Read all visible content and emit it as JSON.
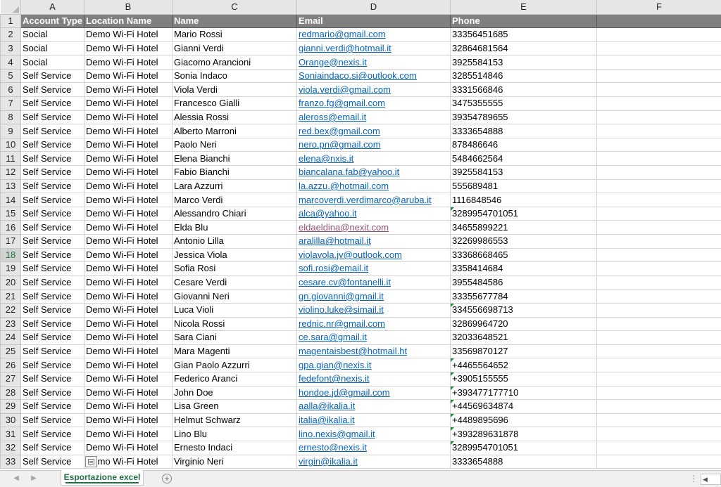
{
  "columns": [
    "A",
    "B",
    "C",
    "D",
    "E",
    "F"
  ],
  "header_row": {
    "row_number": "1",
    "cells": [
      "Account Type",
      "Location Name",
      "Name",
      "Email",
      "Phone",
      ""
    ]
  },
  "selected_row": "18",
  "rows": [
    {
      "n": "2",
      "type": "Social",
      "location": "Demo Wi-Fi Hotel",
      "name": "Mario Rossi",
      "email": "redmario@gmail.com",
      "phone": "33356451685",
      "phone_warning": false
    },
    {
      "n": "3",
      "type": "Social",
      "location": "Demo Wi-Fi Hotel",
      "name": "Gianni Verdi",
      "email": "gianni.verdi@hotmail.it",
      "phone": "32864681564",
      "phone_warning": false
    },
    {
      "n": "4",
      "type": "Social",
      "location": "Demo Wi-Fi Hotel",
      "name": "Giacomo Arancioni",
      "email": "Orange@nexis.it",
      "phone": "3925584153",
      "phone_warning": false
    },
    {
      "n": "5",
      "type": "Self Service",
      "location": "Demo Wi-Fi Hotel",
      "name": "Sonia Indaco",
      "email": "Soniaindaco.si@outlook.com",
      "phone": "3285514846",
      "phone_warning": false
    },
    {
      "n": "6",
      "type": "Self Service",
      "location": "Demo Wi-Fi Hotel",
      "name": "Viola Verdi",
      "email": "viola.verdi@gmail.com",
      "phone": "3331566846",
      "phone_warning": false
    },
    {
      "n": "7",
      "type": "Self Service",
      "location": "Demo Wi-Fi Hotel",
      "name": "Francesco Gialli",
      "email": "franzo.fg@gmail.com",
      "phone": "3475355555",
      "phone_warning": false
    },
    {
      "n": "8",
      "type": "Self Service",
      "location": "Demo Wi-Fi Hotel",
      "name": "Alessia Rossi",
      "email": "aleross@email.it",
      "phone": "39354789655",
      "phone_warning": false
    },
    {
      "n": "9",
      "type": "Self Service",
      "location": "Demo Wi-Fi Hotel",
      "name": "Alberto Marroni",
      "email": "red.bex@gmail.com",
      "phone": "3333654888",
      "phone_warning": false
    },
    {
      "n": "10",
      "type": "Self Service",
      "location": "Demo Wi-Fi Hotel",
      "name": "Paolo Neri",
      "email": "nero.pn@gmail.com",
      "phone": "878486646",
      "phone_warning": false
    },
    {
      "n": "11",
      "type": "Self Service",
      "location": "Demo Wi-Fi Hotel",
      "name": "Elena Bianchi",
      "email": "elena@nxis.it",
      "phone": "5484662564",
      "phone_warning": false
    },
    {
      "n": "12",
      "type": "Self Service",
      "location": "Demo Wi-Fi Hotel",
      "name": "Fabio Bianchi",
      "email": "biancalana.fab@yahoo.it",
      "phone": "3925584153",
      "phone_warning": false
    },
    {
      "n": "13",
      "type": "Self Service",
      "location": "Demo Wi-Fi Hotel",
      "name": "Lara Azzurri",
      "email": "la.azzu.@hotmail.com",
      "phone": "555689481",
      "phone_warning": false
    },
    {
      "n": "14",
      "type": "Self Service",
      "location": "Demo Wi-Fi Hotel",
      "name": "Marco Verdi",
      "email": "marcoverdi.verdimarco@aruba.it",
      "phone": "1116848546",
      "phone_warning": false
    },
    {
      "n": "15",
      "type": "Self Service",
      "location": "Demo Wi-Fi Hotel",
      "name": "Alessandro Chiari",
      "email": "alca@yahoo.it",
      "phone": "3289954701051",
      "phone_warning": true
    },
    {
      "n": "16",
      "type": "Self Service",
      "location": "Demo Wi-Fi Hotel",
      "name": "Elda Blu",
      "email": "eldaeldina@nexit.com",
      "phone": "34655899221",
      "phone_warning": false,
      "visited": true
    },
    {
      "n": "17",
      "type": "Self Service",
      "location": "Demo Wi-Fi Hotel",
      "name": "Antonio Lilla",
      "email": "aralilla@hotmail.it",
      "phone": "32269986553",
      "phone_warning": false
    },
    {
      "n": "18",
      "type": "Self Service",
      "location": "Demo Wi-Fi Hotel",
      "name": "Jessica Viola",
      "email": "violavola.jv@outlook.com",
      "phone": "33368668465",
      "phone_warning": false
    },
    {
      "n": "19",
      "type": "Self Service",
      "location": "Demo Wi-Fi Hotel",
      "name": "Sofia Rosi",
      "email": "sofi.rosi@email.it",
      "phone": "3358414684",
      "phone_warning": false
    },
    {
      "n": "20",
      "type": "Self Service",
      "location": "Demo Wi-Fi Hotel",
      "name": "Cesare Verdi",
      "email": "cesare.cv@fontanelli.it",
      "phone": "3955484586",
      "phone_warning": false
    },
    {
      "n": "21",
      "type": "Self Service",
      "location": "Demo Wi-Fi Hotel",
      "name": "Giovanni Neri",
      "email": "gn.giovanni@gmail.it",
      "phone": "33355677784",
      "phone_warning": false
    },
    {
      "n": "22",
      "type": "Self Service",
      "location": "Demo Wi-Fi Hotel",
      "name": "Luca Violi",
      "email": "violino.luke@simail.it",
      "phone": "334556698713",
      "phone_warning": true
    },
    {
      "n": "23",
      "type": "Self Service",
      "location": "Demo Wi-Fi Hotel",
      "name": "Nicola Rossi",
      "email": "rednic.nr@gmail.com",
      "phone": "32869964720",
      "phone_warning": false
    },
    {
      "n": "24",
      "type": "Self Service",
      "location": "Demo Wi-Fi Hotel",
      "name": "Sara Ciani",
      "email": "ce.sara@gmail.it",
      "phone": "32033648521",
      "phone_warning": false
    },
    {
      "n": "25",
      "type": "Self Service",
      "location": "Demo Wi-Fi Hotel",
      "name": "Mara Magenti",
      "email": "magentaisbest@hotmail.ht",
      "phone": "33569870127",
      "phone_warning": false
    },
    {
      "n": "26",
      "type": "Self Service",
      "location": "Demo Wi-Fi Hotel",
      "name": "Gian Paolo Azzurri",
      "email": "gpa.gian@nexis.it",
      "phone": "+4465564652",
      "phone_warning": true
    },
    {
      "n": "27",
      "type": "Self Service",
      "location": "Demo Wi-Fi Hotel",
      "name": "Federico Aranci",
      "email": "fedefont@nexis.it",
      "phone": "+3905155555",
      "phone_warning": true
    },
    {
      "n": "28",
      "type": "Self Service",
      "location": "Demo Wi-Fi Hotel",
      "name": "John Doe",
      "email": "hondoe.jd@gmail.com",
      "phone": "+393477177710",
      "phone_warning": true
    },
    {
      "n": "29",
      "type": "Self Service",
      "location": "Demo Wi-Fi Hotel",
      "name": "Lisa Green",
      "email": "aalla@ikalia.it",
      "phone": "+44569634874",
      "phone_warning": true
    },
    {
      "n": "30",
      "type": "Self Service",
      "location": "Demo Wi-Fi Hotel",
      "name": "Helmut Schwarz",
      "email": "italia@ikalia.it",
      "phone": "+4489895696",
      "phone_warning": true
    },
    {
      "n": "31",
      "type": "Self Service",
      "location": "Demo Wi-Fi Hotel",
      "name": "Lino Blu",
      "email": "lino.nexis@gmail.it",
      "phone": "+393289631878",
      "phone_warning": true
    },
    {
      "n": "32",
      "type": "Self Service",
      "location": "Demo Wi-Fi Hotel",
      "name": "Ernesto Indaci",
      "email": "ernesto@nexis.it",
      "phone": "3289954701051",
      "phone_warning": true
    },
    {
      "n": "33",
      "type": "Self Service",
      "location": "Demo Wi-Fi Hotel",
      "name": "Virginio Neri",
      "email": "virgin@ikalia.it",
      "phone": "3333654888",
      "phone_warning": false,
      "paste_options_icon": true
    }
  ],
  "sheet_tabs": [
    {
      "label": "Esportazione excel",
      "active": true
    }
  ],
  "icons": {
    "tab_prev": "chevron-left-icon",
    "tab_next": "chevron-right-icon",
    "add_sheet": "plus-circle-icon",
    "paste_options": "paste-options-icon",
    "scroll_left": "scroll-left-icon"
  },
  "colors": {
    "header_fill": "#808080",
    "header_text": "#ffffff",
    "link": "#0563c1",
    "visited_link": "#954f72",
    "error_indicator": "#1e8a3a",
    "excel_green": "#217346"
  },
  "glyphs": {
    "tab_prev": "◀",
    "tab_next": "▶",
    "add_sheet": "+",
    "tab_dots": "⋮",
    "scroll_left": "◀"
  }
}
